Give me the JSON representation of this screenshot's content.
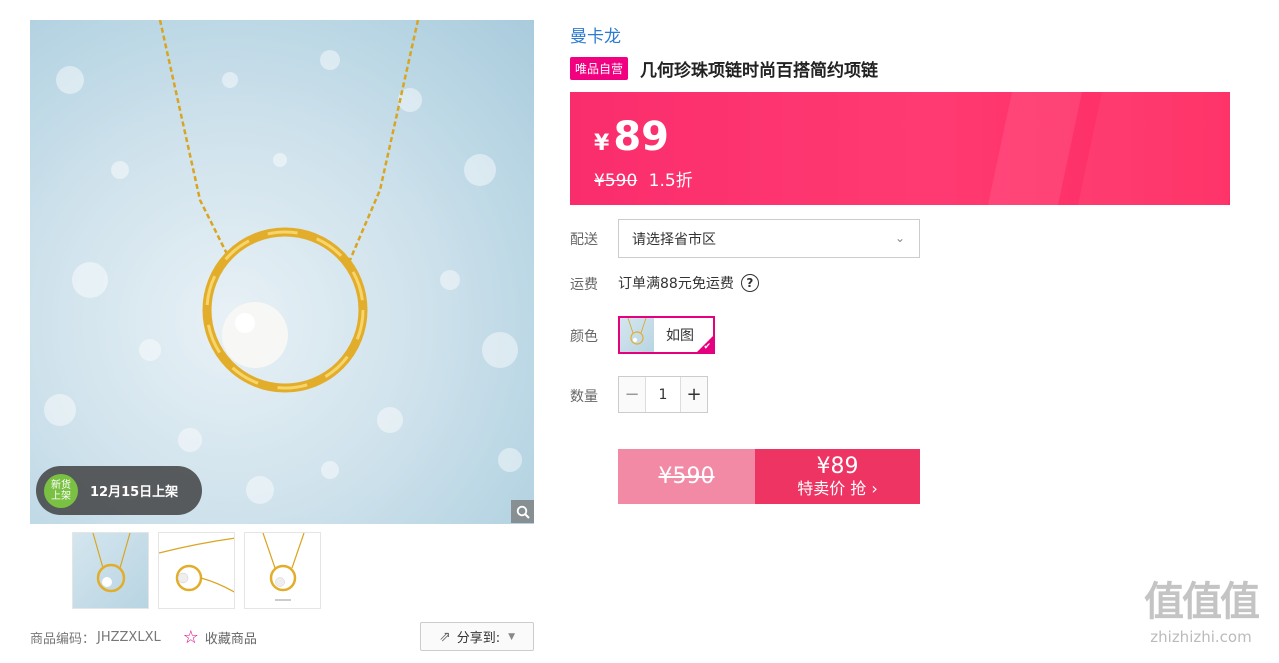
{
  "gallery": {
    "new_badge_line1": "新货",
    "new_badge_line2": "上架",
    "launch_date": "12月15日上架",
    "zoom_icon": "magnifier-icon",
    "thumbnails": [
      "thumb-1",
      "thumb-2",
      "thumb-3"
    ]
  },
  "meta": {
    "product_code_label": "商品编码：",
    "product_code": "JHZZXLXL",
    "favorite_label": "收藏商品",
    "share_label": "分享到:"
  },
  "product": {
    "brand": "曼卡龙",
    "self_operated_tag": "唯品自营",
    "title": "几何珍珠项链时尚百搭简约项链"
  },
  "price": {
    "currency": "¥",
    "current": "89",
    "original": "¥590",
    "discount": "1.5折"
  },
  "options": {
    "delivery_label": "配送",
    "delivery_placeholder": "请选择省市区",
    "shipping_label": "运费",
    "shipping_text": "订单满88元免运费",
    "color_label": "颜色",
    "color_value": "如图",
    "quantity_label": "数量",
    "quantity_value": "1"
  },
  "buy": {
    "original": "¥590",
    "price": "¥89",
    "label": "特卖价 抢",
    "arrow": "›"
  },
  "watermark": {
    "logo": "值值值",
    "url": "zhizhizhi.com"
  },
  "colors": {
    "accent": "#f10180",
    "price_bg": "#fa2d6c",
    "buy_left": "#f28aa6",
    "buy_right": "#ee3463",
    "brand_link": "#2b7bd1"
  }
}
